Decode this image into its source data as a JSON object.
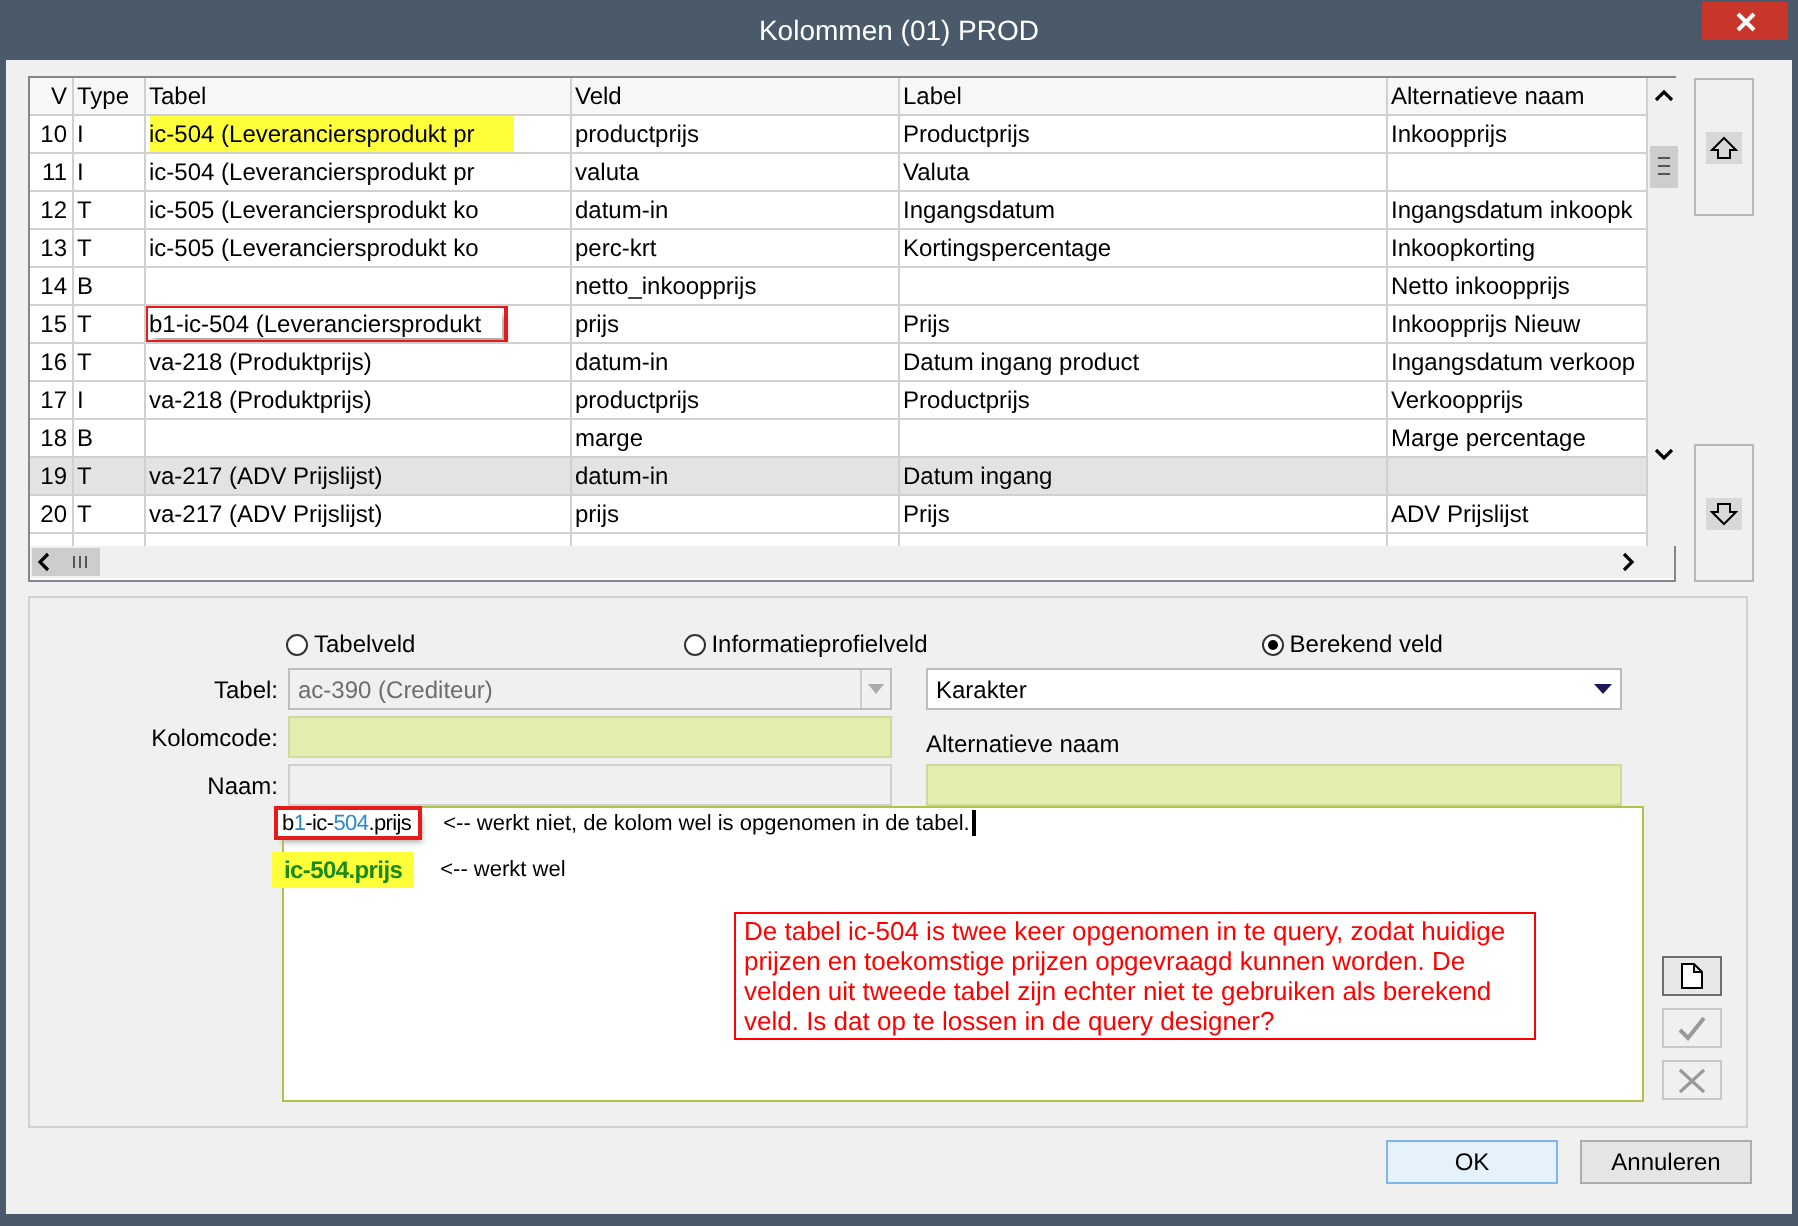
{
  "window": {
    "title": "Kolommen (01)  PROD"
  },
  "table": {
    "columns": [
      "V",
      "Type",
      "Tabel",
      "Veld",
      "Label",
      "Alternatieve naam"
    ],
    "rows": [
      {
        "cells": [
          "10",
          "I",
          "ic-504 (Leveranciersprodukt pr",
          "productprijs",
          "Productprijs",
          "Inkoopprijs"
        ],
        "selected": false,
        "tabel_highlighted": true,
        "tabel_boxed": false
      },
      {
        "cells": [
          "11",
          "I",
          "ic-504 (Leveranciersprodukt pr",
          "valuta",
          "Valuta",
          ""
        ],
        "selected": false,
        "tabel_highlighted": false,
        "tabel_boxed": false
      },
      {
        "cells": [
          "12",
          "T",
          "ic-505 (Leveranciersprodukt ko",
          "datum-in",
          "Ingangsdatum",
          "Ingangsdatum inkoopk"
        ],
        "selected": false,
        "tabel_highlighted": false,
        "tabel_boxed": false
      },
      {
        "cells": [
          "13",
          "T",
          "ic-505 (Leveranciersprodukt ko",
          "perc-krt",
          "Kortingspercentage",
          "Inkoopkorting"
        ],
        "selected": false,
        "tabel_highlighted": false,
        "tabel_boxed": false
      },
      {
        "cells": [
          "14",
          "B",
          "",
          "netto_inkoopprijs",
          "",
          "Netto inkoopprijs"
        ],
        "selected": false
      },
      {
        "cells": [
          "15",
          "T",
          "b1-ic-504 (Leveranciersprodukt",
          "prijs",
          "Prijs",
          "Inkoopprijs Nieuw"
        ],
        "selected": false,
        "tabel_highlighted": false,
        "tabel_boxed": true
      },
      {
        "cells": [
          "16",
          "T",
          "va-218 (Produktprijs)",
          "datum-in",
          "Datum ingang product",
          "Ingangsdatum verkoop"
        ],
        "selected": false,
        "tabel_highlighted": false,
        "tabel_boxed": false
      },
      {
        "cells": [
          "17",
          "I",
          "va-218 (Produktprijs)",
          "productprijs",
          "Productprijs",
          "Verkoopprijs"
        ],
        "selected": false,
        "tabel_highlighted": false,
        "tabel_boxed": false
      },
      {
        "cells": [
          "18",
          "B",
          "",
          "marge",
          "",
          "Marge percentage"
        ],
        "selected": false
      },
      {
        "cells": [
          "19",
          "T",
          "va-217 (ADV Prijslijst)",
          "datum-in",
          "Datum ingang",
          ""
        ],
        "selected": true,
        "tabel_highlighted": false,
        "tabel_boxed": false
      },
      {
        "cells": [
          "20",
          "T",
          "va-217 (ADV Prijslijst)",
          "prijs",
          "Prijs",
          "ADV Prijslijst"
        ],
        "selected": false,
        "tabel_highlighted": false,
        "tabel_boxed": false
      }
    ]
  },
  "options": [
    {
      "label": "Tabelveld",
      "selected": false
    },
    {
      "label": "Informatieprofielveld",
      "selected": false
    },
    {
      "label": "Berekend veld",
      "selected": true
    }
  ],
  "form": {
    "tabel": {
      "label": "Tabel:",
      "value": "ac-390 (Crediteur)",
      "disabled": true
    },
    "type": {
      "value": "Karakter"
    },
    "kolomcode": {
      "label": "Kolomcode:",
      "required": true
    },
    "naam": {
      "label": "Naam:",
      "required": false
    },
    "alt_naam": {
      "label": "Alternatieve naam",
      "required": true
    }
  },
  "expression": {
    "line1": {
      "code": [
        {
          "text": "b",
          "kind": "plain"
        },
        {
          "text": "1",
          "kind": "number"
        },
        {
          "text": "-ic-",
          "kind": "plain"
        },
        {
          "text": "504",
          "kind": "number"
        },
        {
          "text": ".prijs",
          "kind": "plain"
        }
      ],
      "boxed": true,
      "highlighted": false,
      "comment": "<-- werkt niet, de kolom wel is opgenomen in de tabel."
    },
    "line2": {
      "code": [
        {
          "text": "ic-504.prijs",
          "kind": "plain"
        }
      ],
      "boxed": false,
      "highlighted": true,
      "comment": "<-- werkt wel"
    },
    "note": "De tabel ic-504 is twee keer opgenomen in te query, zodat huidige prijzen en toekomstige prijzen opgevraagd kunnen worden. De velden uit tweede tabel zijn echter niet te gebruiken als berekend veld. Is dat op te lossen in de query designer?"
  },
  "side_buttons": [
    {
      "kind": "new",
      "disabled": false
    },
    {
      "kind": "check",
      "disabled": true
    },
    {
      "kind": "delete",
      "disabled": true
    }
  ],
  "buttons": [
    {
      "label": "OK",
      "default": true
    },
    {
      "label": "Annuleren",
      "default": false
    }
  ]
}
